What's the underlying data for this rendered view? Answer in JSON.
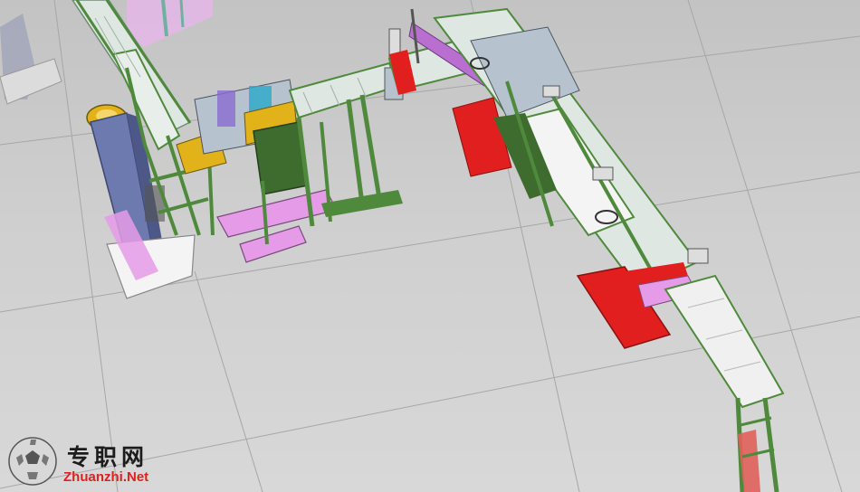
{
  "viewport": {
    "background_top": "#c3c3c3",
    "background_bottom": "#d8d8d8",
    "grid_color": "#9e9e9e"
  },
  "model": {
    "colors": {
      "frame_green": "#4f8a3c",
      "conveyor_light": "#dfe7e3",
      "base_pink": "#e59be8",
      "guard_red": "#e11f1f",
      "column_slate": "#6d7ab0",
      "plate_white": "#f4f4f4",
      "accent_yellow": "#e2b21a",
      "accent_cyan": "#2aa7c9"
    }
  },
  "watermark": {
    "logo_icon": "soccer-ball-globe-icon",
    "title": "专职网",
    "url": "Zhuanzhi.Net"
  }
}
